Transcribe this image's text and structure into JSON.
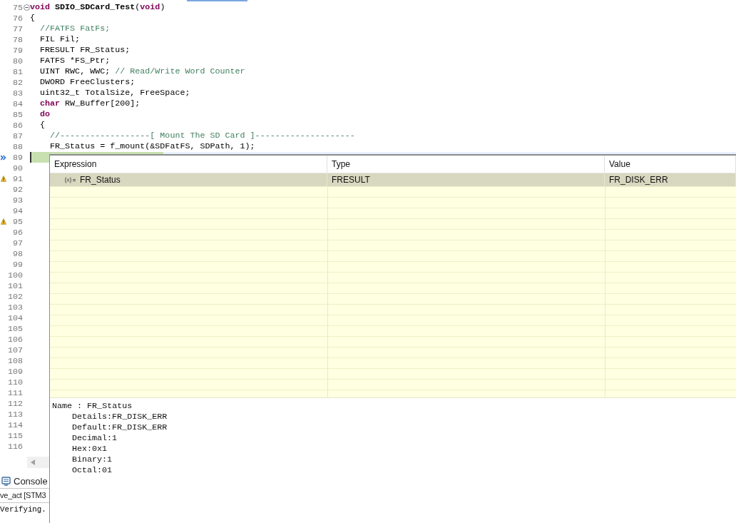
{
  "editor": {
    "lines": [
      {
        "number": "75",
        "kind": "fold",
        "tokens": [
          {
            "text": "void",
            "kind": "keyword"
          },
          {
            "text": " SDIO_SDCard_Test",
            "kind": "function"
          },
          {
            "text": "(",
            "kind": "plain"
          },
          {
            "text": "void",
            "kind": "keyword"
          },
          {
            "text": ")",
            "kind": "plain"
          }
        ]
      },
      {
        "number": "76",
        "kind": "plain",
        "tokens": [
          {
            "text": "{",
            "kind": "plain"
          }
        ]
      },
      {
        "number": "77",
        "kind": "plain",
        "tokens": [
          {
            "text": "  //FATFS FatFs;",
            "kind": "comment"
          }
        ]
      },
      {
        "number": "78",
        "kind": "plain",
        "tokens": [
          {
            "text": "  FIL Fil;",
            "kind": "plain"
          }
        ]
      },
      {
        "number": "79",
        "kind": "plain",
        "tokens": [
          {
            "text": "  FRESULT FR_Status;",
            "kind": "plain"
          }
        ]
      },
      {
        "number": "80",
        "kind": "plain",
        "tokens": [
          {
            "text": "  FATFS *FS_Ptr;",
            "kind": "plain"
          }
        ]
      },
      {
        "number": "81",
        "kind": "plain",
        "tokens": [
          {
            "text": "  UINT RWC, WWC; ",
            "kind": "plain"
          },
          {
            "text": "// Read/Write Word Counter",
            "kind": "comment"
          }
        ]
      },
      {
        "number": "82",
        "kind": "plain",
        "tokens": [
          {
            "text": "  DWORD FreeClusters;",
            "kind": "plain"
          }
        ]
      },
      {
        "number": "83",
        "kind": "plain",
        "tokens": [
          {
            "text": "  uint32_t TotalSize, FreeSpace;",
            "kind": "plain"
          }
        ]
      },
      {
        "number": "84",
        "kind": "plain",
        "tokens": [
          {
            "text": "  char",
            "kind": "keyword"
          },
          {
            "text": " RW_Buffer[200];",
            "kind": "plain"
          }
        ]
      },
      {
        "number": "85",
        "kind": "plain",
        "tokens": [
          {
            "text": "  do",
            "kind": "keyword"
          }
        ]
      },
      {
        "number": "86",
        "kind": "plain",
        "tokens": [
          {
            "text": "  {",
            "kind": "plain"
          }
        ]
      },
      {
        "number": "87",
        "kind": "plain",
        "tokens": [
          {
            "text": "    //------------------[ Mount The SD Card ]--------------------",
            "kind": "comment"
          }
        ]
      },
      {
        "number": "88",
        "kind": "plain",
        "tokens": [
          {
            "text": "    FR_Status = f_mount(&SDFatFS, SDPath, 1);",
            "kind": "plain"
          }
        ]
      },
      {
        "number": "89",
        "kind": "debug",
        "current": true
      },
      {
        "number": "90",
        "kind": "plain"
      },
      {
        "number": "91",
        "kind": "warning"
      },
      {
        "number": "92",
        "kind": "plain"
      },
      {
        "number": "93",
        "kind": "plain"
      },
      {
        "number": "94",
        "kind": "plain"
      },
      {
        "number": "95",
        "kind": "warning"
      },
      {
        "number": "96",
        "kind": "plain"
      },
      {
        "number": "97",
        "kind": "plain"
      },
      {
        "number": "98",
        "kind": "plain"
      },
      {
        "number": "99",
        "kind": "plain"
      },
      {
        "number": "100",
        "kind": "plain"
      },
      {
        "number": "101",
        "kind": "plain"
      },
      {
        "number": "102",
        "kind": "plain"
      },
      {
        "number": "103",
        "kind": "plain"
      },
      {
        "number": "104",
        "kind": "plain"
      },
      {
        "number": "105",
        "kind": "plain"
      },
      {
        "number": "106",
        "kind": "plain"
      },
      {
        "number": "107",
        "kind": "plain"
      },
      {
        "number": "108",
        "kind": "plain"
      },
      {
        "number": "109",
        "kind": "plain"
      },
      {
        "number": "110",
        "kind": "plain"
      },
      {
        "number": "111",
        "kind": "plain"
      },
      {
        "number": "112",
        "kind": "plain"
      },
      {
        "number": "113",
        "kind": "plain"
      },
      {
        "number": "114",
        "kind": "plain"
      },
      {
        "number": "115",
        "kind": "plain"
      },
      {
        "number": "116",
        "kind": "plain"
      }
    ]
  },
  "console": {
    "tab": "Console",
    "lines": [
      "ve_act [STM3",
      "Verifying."
    ]
  },
  "watch": {
    "columns": [
      "Expression",
      "Type",
      "Value"
    ],
    "rows": [
      {
        "expression": "FR_Status",
        "type": "FRESULT",
        "value": "FR_DISK_ERR",
        "selected": true
      }
    ],
    "details": [
      {
        "text": "Name : FR_Status",
        "indent": false
      },
      {
        "text": "Details:FR_DISK_ERR",
        "indent": true
      },
      {
        "text": "Default:FR_DISK_ERR",
        "indent": true
      },
      {
        "text": "Decimal:1",
        "indent": true
      },
      {
        "text": "Hex:0x1",
        "indent": true
      },
      {
        "text": "Binary:1",
        "indent": true
      },
      {
        "text": "Octal:01",
        "indent": true
      }
    ]
  }
}
